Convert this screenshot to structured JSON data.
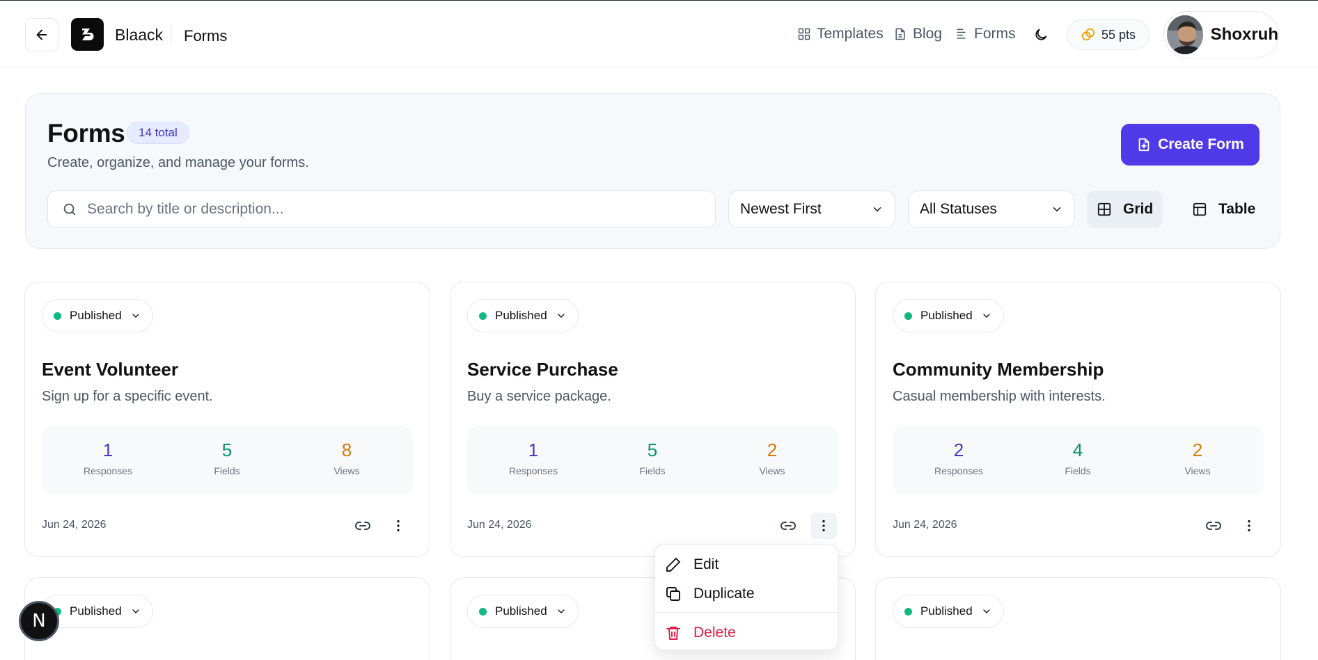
{
  "header": {
    "brand": "Blaack",
    "breadcrumb": "Forms",
    "nav": [
      {
        "label": "Templates",
        "icon": "grid-icon"
      },
      {
        "label": "Blog",
        "icon": "document-icon"
      },
      {
        "label": "Forms",
        "icon": "list-icon"
      }
    ],
    "points": "55 pts",
    "user_name": "Shoxruh"
  },
  "page": {
    "title": "Forms",
    "total_badge": "14 total",
    "subtitle": "Create, organize, and manage your forms.",
    "create_label": "Create Form",
    "search_placeholder": "Search by title or description...",
    "sort_value": "Newest First",
    "status_value": "All Statuses",
    "view_grid": "Grid",
    "view_table": "Table"
  },
  "stat_labels": {
    "responses": "Responses",
    "fields": "Fields",
    "views": "Views"
  },
  "stat_colors": {
    "responses": "#4338ca",
    "fields": "#059669",
    "views": "#d97706"
  },
  "cards": [
    {
      "status": "Published",
      "title": "Event Volunteer",
      "description": "Sign up for a specific event.",
      "responses": "1",
      "fields": "5",
      "views": "8",
      "date": "Jun 24, 2026"
    },
    {
      "status": "Published",
      "title": "Service Purchase",
      "description": "Buy a service package.",
      "responses": "1",
      "fields": "5",
      "views": "2",
      "date": "Jun 24, 2026"
    },
    {
      "status": "Published",
      "title": "Community Membership",
      "description": "Casual membership with interests.",
      "responses": "2",
      "fields": "4",
      "views": "2",
      "date": "Jun 24, 2026"
    },
    {
      "status": "Published"
    },
    {
      "status": "Published"
    },
    {
      "status": "Published"
    }
  ],
  "menu": {
    "edit": "Edit",
    "duplicate": "Duplicate",
    "delete": "Delete"
  },
  "next_badge": "N"
}
